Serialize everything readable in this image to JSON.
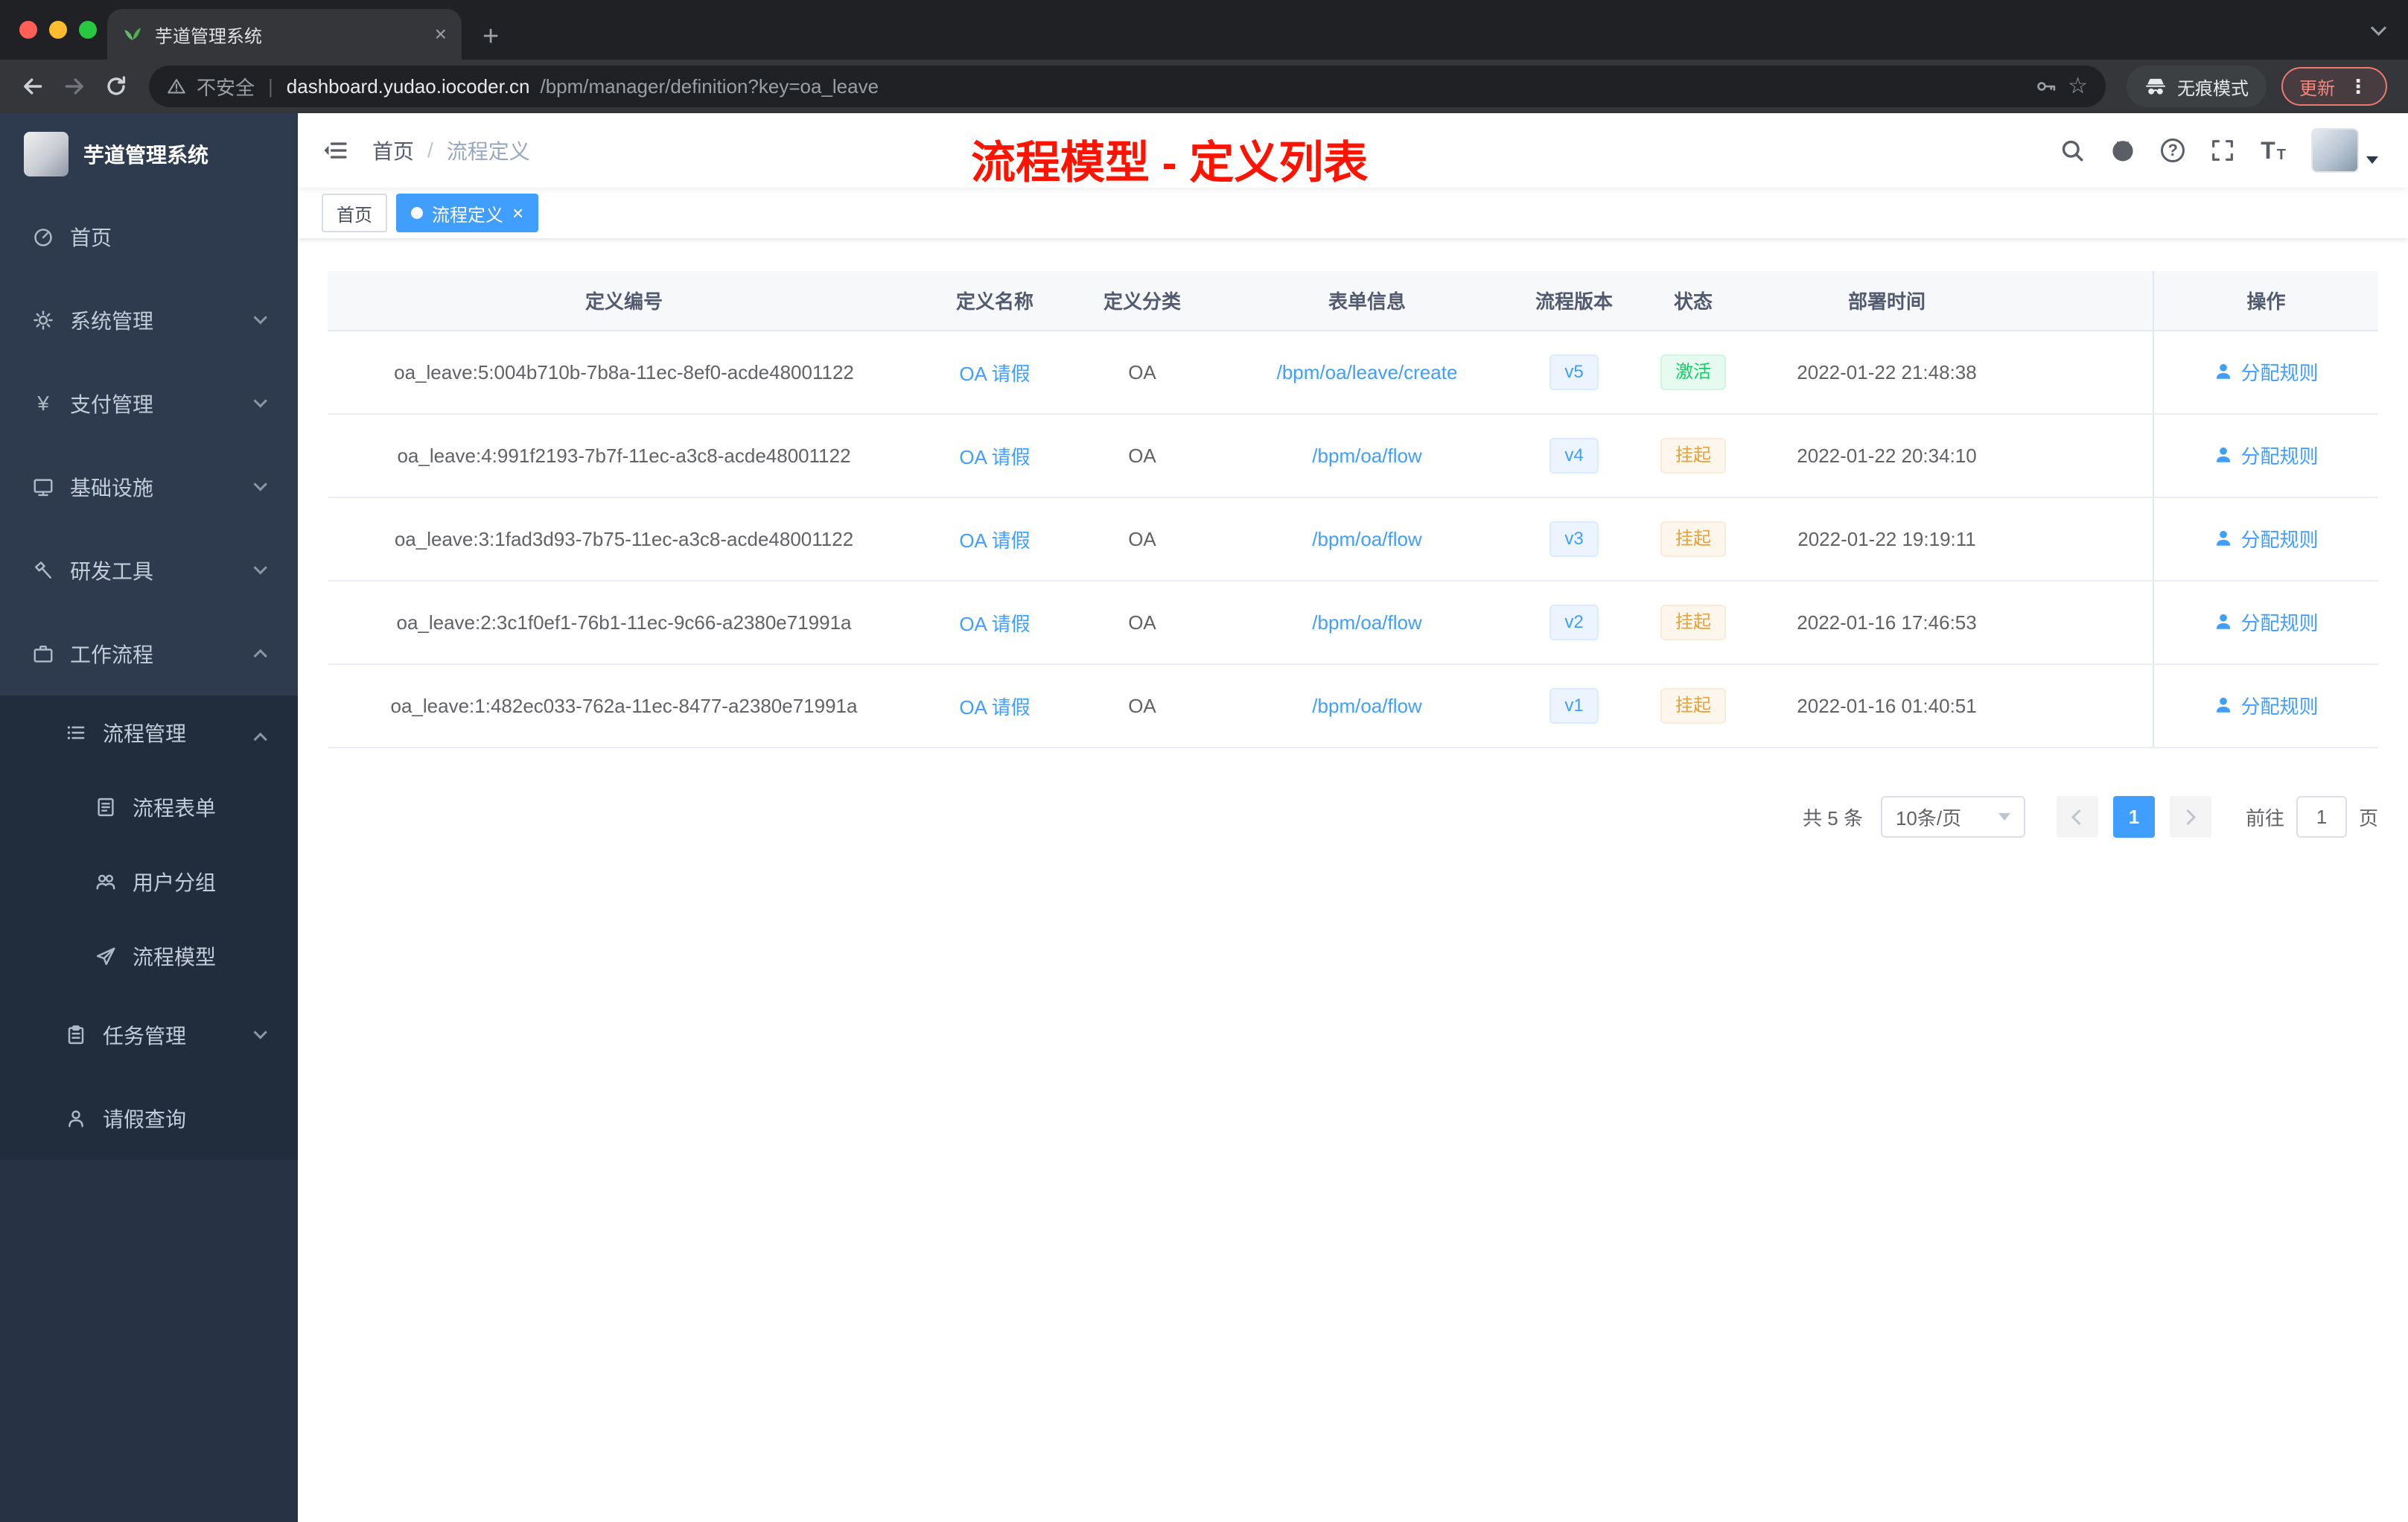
{
  "colors": {
    "accent": "#409eff",
    "annotation_red": "#fe1200",
    "status_success": "#13ce66",
    "status_warning": "#e6a23c",
    "sidebar_bg": "#2e3b4f",
    "browser_dark": "#202124"
  },
  "icons": {
    "close_glyph": "×",
    "new_tab_glyph": "+",
    "kebab_glyph": "⋮",
    "star_glyph": "☆",
    "payment_glyph": "¥"
  },
  "browser": {
    "tab": {
      "title": "芋道管理系统"
    },
    "omnibox": {
      "security_label": "不安全",
      "divider": "|",
      "host": "dashboard.yudao.iocoder.cn",
      "path": "/bpm/manager/definition?key=oa_leave"
    },
    "incognito_label": "无痕模式",
    "update_label": "更新"
  },
  "sidebar": {
    "logo_title": "芋道管理系统",
    "menu": [
      {
        "label": "首页",
        "icon": "dashboard-icon"
      },
      {
        "label": "系统管理",
        "icon": "gear-icon",
        "arrow": "down"
      },
      {
        "label": "支付管理",
        "icon": "payment-icon",
        "arrow": "down"
      },
      {
        "label": "基础设施",
        "icon": "infrastructure-icon",
        "arrow": "down"
      },
      {
        "label": "研发工具",
        "icon": "devtools-icon",
        "arrow": "down"
      },
      {
        "label": "工作流程",
        "icon": "workflow-icon",
        "arrow": "up"
      },
      {
        "label": "流程管理",
        "icon": "process-list-icon",
        "arrow": "up"
      },
      {
        "label": "流程表单",
        "icon": "form-icon"
      },
      {
        "label": "用户分组",
        "icon": "user-group-icon"
      },
      {
        "label": "流程模型",
        "icon": "paper-plane-icon"
      },
      {
        "label": "任务管理",
        "icon": "task-icon",
        "arrow": "down"
      },
      {
        "label": "请假查询",
        "icon": "user-icon"
      }
    ]
  },
  "header": {
    "breadcrumb": {
      "home": "首页",
      "separator": "/",
      "current": "流程定义"
    },
    "annotation": "流程模型 - 定义列表"
  },
  "tags": [
    {
      "label": "首页",
      "active": false
    },
    {
      "label": "流程定义",
      "active": true
    }
  ],
  "table": {
    "columns": [
      "定义编号",
      "定义名称",
      "定义分类",
      "表单信息",
      "流程版本",
      "状态",
      "部署时间",
      "操作"
    ],
    "rows": [
      {
        "id": "oa_leave:5:004b710b-7b8a-11ec-8ef0-acde48001122",
        "name": "OA 请假",
        "category": "OA",
        "form": "/bpm/oa/leave/create",
        "version": "v5",
        "status": "激活",
        "status_type": "success",
        "deploy_time": "2022-01-22 21:48:38",
        "action": "分配规则"
      },
      {
        "id": "oa_leave:4:991f2193-7b7f-11ec-a3c8-acde48001122",
        "name": "OA 请假",
        "category": "OA",
        "form": "/bpm/oa/flow",
        "version": "v4",
        "status": "挂起",
        "status_type": "warning",
        "deploy_time": "2022-01-22 20:34:10",
        "action": "分配规则"
      },
      {
        "id": "oa_leave:3:1fad3d93-7b75-11ec-a3c8-acde48001122",
        "name": "OA 请假",
        "category": "OA",
        "form": "/bpm/oa/flow",
        "version": "v3",
        "status": "挂起",
        "status_type": "warning",
        "deploy_time": "2022-01-22 19:19:11",
        "action": "分配规则"
      },
      {
        "id": "oa_leave:2:3c1f0ef1-76b1-11ec-9c66-a2380e71991a",
        "name": "OA 请假",
        "category": "OA",
        "form": "/bpm/oa/flow",
        "version": "v2",
        "status": "挂起",
        "status_type": "warning",
        "deploy_time": "2022-01-16 17:46:53",
        "action": "分配规则"
      },
      {
        "id": "oa_leave:1:482ec033-762a-11ec-8477-a2380e71991a",
        "name": "OA 请假",
        "category": "OA",
        "form": "/bpm/oa/flow",
        "version": "v1",
        "status": "挂起",
        "status_type": "warning",
        "deploy_time": "2022-01-16 01:40:51",
        "action": "分配规则"
      }
    ]
  },
  "pagination": {
    "total": "共 5 条",
    "page_size": "10条/页",
    "current": "1",
    "goto_prefix": "前往",
    "goto_value": "1",
    "goto_suffix": "页"
  }
}
